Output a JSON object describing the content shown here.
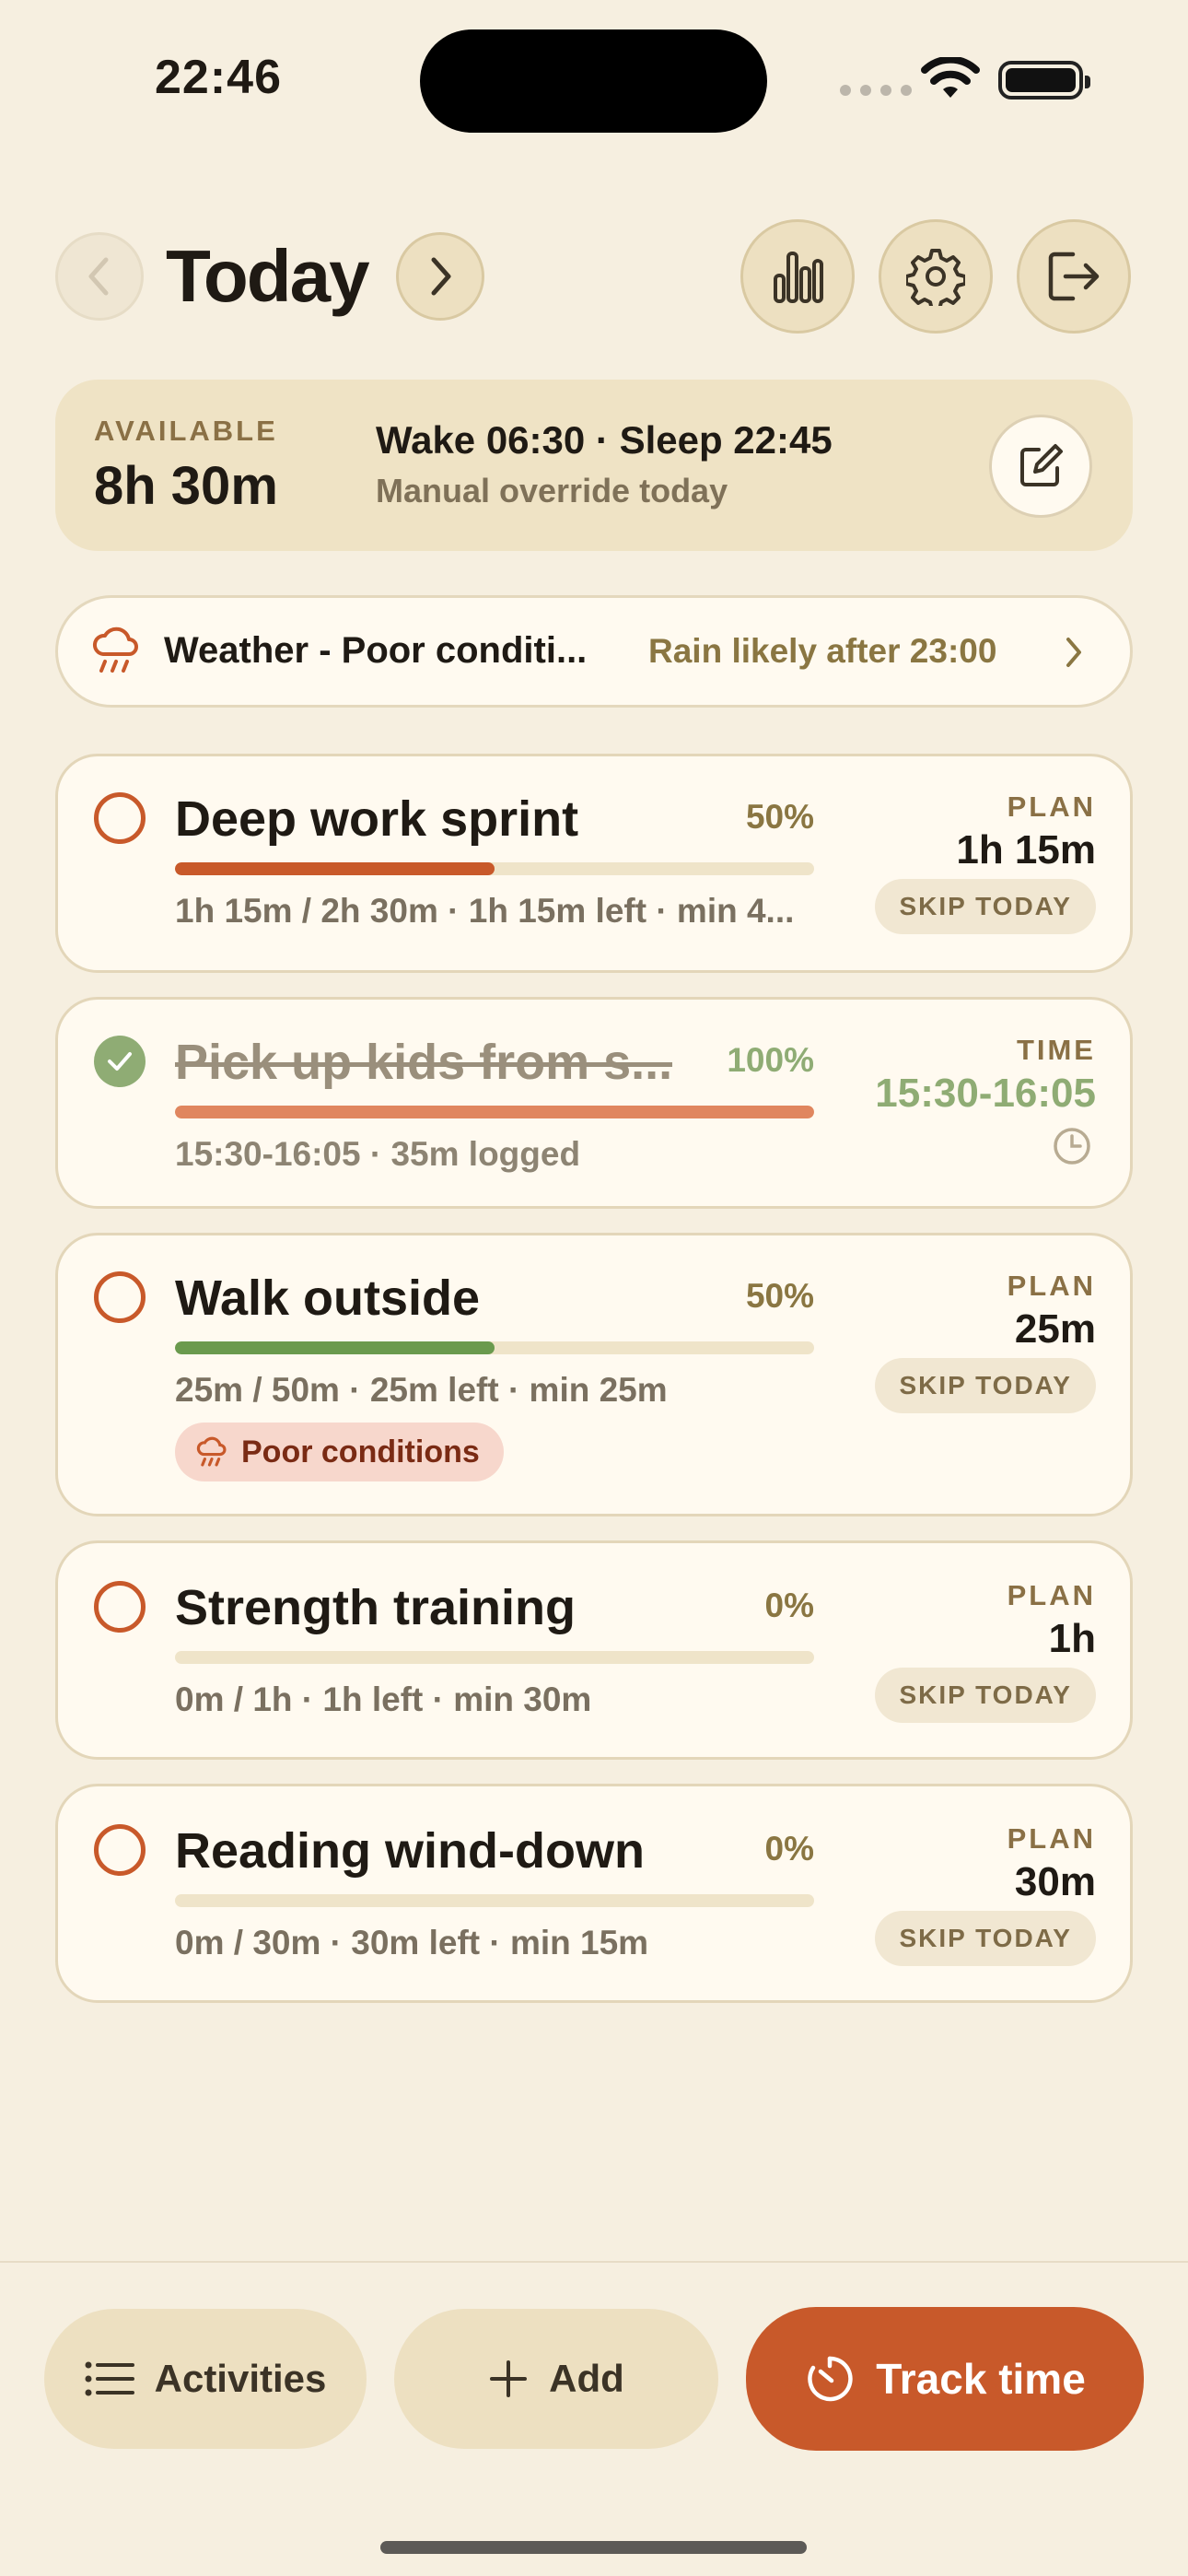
{
  "status_bar": {
    "time": "22:46"
  },
  "header": {
    "title": "Today"
  },
  "availability": {
    "label": "AVAILABLE",
    "value": "8h 30m",
    "schedule": "Wake 06:30 · Sleep 22:45",
    "note": "Manual override today"
  },
  "weather": {
    "title": "Weather - Poor conditi...",
    "note": "Rain likely after 23:00"
  },
  "activities": [
    {
      "title": "Deep work sprint",
      "percent": "50%",
      "progress": 0.5,
      "bar_color": "#c8592a",
      "subtitle": "1h 15m / 2h 30m · 1h 15m left · min 4...",
      "right_label": "PLAN",
      "right_value": "1h 15m",
      "action": "SKIP TODAY",
      "done": false
    },
    {
      "title": "Pick up kids from s...",
      "percent": "100%",
      "progress": 1.0,
      "bar_color": "#e0865f",
      "subtitle": "15:30-16:05 · 35m logged",
      "right_label": "TIME",
      "right_value": "15:30-16:05",
      "done": true
    },
    {
      "title": "Walk outside",
      "percent": "50%",
      "progress": 0.5,
      "bar_color": "#6a9a4e",
      "subtitle": "25m / 50m · 25m left · min 25m",
      "right_label": "PLAN",
      "right_value": "25m",
      "action": "SKIP TODAY",
      "tag": "Poor conditions",
      "done": false
    },
    {
      "title": "Strength training",
      "percent": "0%",
      "progress": 0,
      "bar_color": "#c8592a",
      "subtitle": "0m / 1h · 1h left · min 30m",
      "right_label": "PLAN",
      "right_value": "1h",
      "action": "SKIP TODAY",
      "done": false
    },
    {
      "title": "Reading wind-down",
      "percent": "0%",
      "progress": 0,
      "bar_color": "#c8592a",
      "subtitle": "0m / 30m · 30m left · min 15m",
      "right_label": "PLAN",
      "right_value": "30m",
      "action": "SKIP TODAY",
      "done": false
    }
  ],
  "bottom_bar": {
    "activities_label": "Activities",
    "add_label": "Add",
    "track_label": "Track time"
  },
  "colors": {
    "background": "#f6efe0",
    "accent": "#c8592a",
    "done": "#8fac74",
    "sand": "#ede0c1"
  },
  "icons": [
    "chevron-left-icon",
    "chevron-right-icon",
    "bar-chart-icon",
    "gear-icon",
    "logout-icon",
    "edit-icon",
    "rain-cloud-icon",
    "check-icon",
    "clock-icon",
    "list-icon",
    "plus-icon",
    "timer-icon"
  ]
}
